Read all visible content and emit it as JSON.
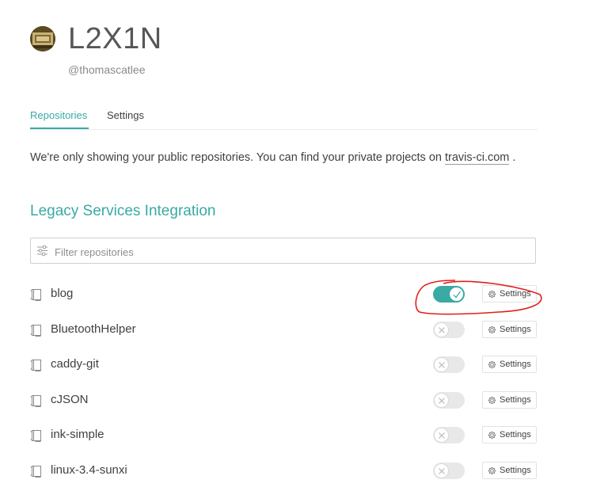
{
  "profile": {
    "name": "L2X1N",
    "login": "@thomascatlee"
  },
  "tabs": [
    {
      "label": "Repositories",
      "active": true
    },
    {
      "label": "Settings",
      "active": false
    }
  ],
  "notice": {
    "text": "We're only showing your public repositories. You can find your private projects on",
    "link": "travis-ci.com",
    "suffix": "."
  },
  "section": {
    "title": "Legacy Services Integration"
  },
  "filter": {
    "placeholder": "Filter repositories",
    "value": ""
  },
  "repositories": [
    {
      "name": "blog",
      "enabled": true,
      "settings_label": "Settings"
    },
    {
      "name": "BluetoothHelper",
      "enabled": false,
      "settings_label": "Settings"
    },
    {
      "name": "caddy-git",
      "enabled": false,
      "settings_label": "Settings"
    },
    {
      "name": "cJSON",
      "enabled": false,
      "settings_label": "Settings"
    },
    {
      "name": "ink-simple",
      "enabled": false,
      "settings_label": "Settings"
    },
    {
      "name": "linux-3.4-sunxi",
      "enabled": false,
      "settings_label": "Settings"
    }
  ],
  "colors": {
    "accent": "#39aaa4",
    "text": "#404040",
    "annotation": "#e0201a"
  },
  "icons": {
    "filter": "sliders-icon",
    "repo": "book-icon",
    "settings": "gear-icon",
    "on": "check-icon",
    "off": "x-icon"
  }
}
